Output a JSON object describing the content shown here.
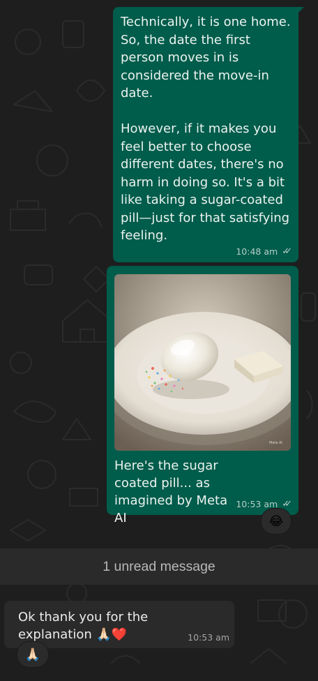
{
  "conversation": {
    "messages": [
      {
        "direction": "outgoing",
        "text": "Technically, it is one home.\nSo, the date the first person moves in is considered the move-in date.\n\nHowever, if it makes you feel better to choose different dates, there's no harm in doing so. It's a bit like taking a sugar-coated pill—just for that satisfying feeling.",
        "time": "10:48 am",
        "status_icon": "double-check-read-icon"
      },
      {
        "direction": "outgoing",
        "image": "ai-generated-sugar-coated-pill-image",
        "image_watermark": "Meta AI",
        "caption": "Here's the sugar coated pill... as imagined by Meta AI",
        "time": "10:53 am",
        "status_icon": "double-check-read-icon",
        "reaction": "😂"
      },
      {
        "direction": "incoming",
        "text": "Ok thank you for the explanation 🙏🏻❤️",
        "time": "10:53 am",
        "reaction": "🙏🏻"
      }
    ],
    "unread_divider": "1 unread message"
  },
  "colors": {
    "background": "#1e1e1e",
    "outgoing_bubble": "#005c4b",
    "incoming_bubble": "#2a2a2a",
    "unread_bar": "#2a2a2a"
  }
}
